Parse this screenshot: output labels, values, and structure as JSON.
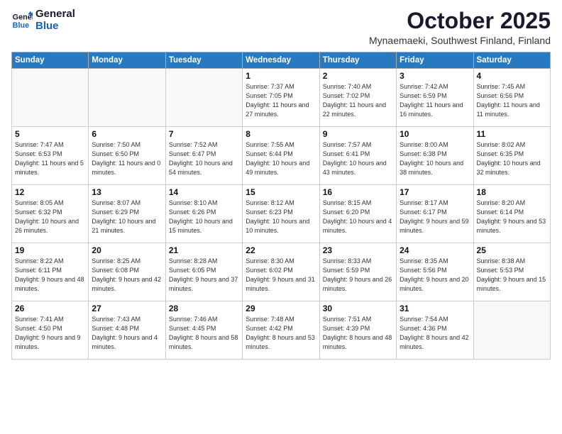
{
  "logo": {
    "line1": "General",
    "line2": "Blue"
  },
  "header": {
    "title": "October 2025",
    "location": "Mynaemaeki, Southwest Finland, Finland"
  },
  "days_of_week": [
    "Sunday",
    "Monday",
    "Tuesday",
    "Wednesday",
    "Thursday",
    "Friday",
    "Saturday"
  ],
  "weeks": [
    [
      {
        "day": "",
        "info": ""
      },
      {
        "day": "",
        "info": ""
      },
      {
        "day": "",
        "info": ""
      },
      {
        "day": "1",
        "info": "Sunrise: 7:37 AM\nSunset: 7:05 PM\nDaylight: 11 hours\nand 27 minutes."
      },
      {
        "day": "2",
        "info": "Sunrise: 7:40 AM\nSunset: 7:02 PM\nDaylight: 11 hours\nand 22 minutes."
      },
      {
        "day": "3",
        "info": "Sunrise: 7:42 AM\nSunset: 6:59 PM\nDaylight: 11 hours\nand 16 minutes."
      },
      {
        "day": "4",
        "info": "Sunrise: 7:45 AM\nSunset: 6:56 PM\nDaylight: 11 hours\nand 11 minutes."
      }
    ],
    [
      {
        "day": "5",
        "info": "Sunrise: 7:47 AM\nSunset: 6:53 PM\nDaylight: 11 hours\nand 5 minutes."
      },
      {
        "day": "6",
        "info": "Sunrise: 7:50 AM\nSunset: 6:50 PM\nDaylight: 11 hours\nand 0 minutes."
      },
      {
        "day": "7",
        "info": "Sunrise: 7:52 AM\nSunset: 6:47 PM\nDaylight: 10 hours\nand 54 minutes."
      },
      {
        "day": "8",
        "info": "Sunrise: 7:55 AM\nSunset: 6:44 PM\nDaylight: 10 hours\nand 49 minutes."
      },
      {
        "day": "9",
        "info": "Sunrise: 7:57 AM\nSunset: 6:41 PM\nDaylight: 10 hours\nand 43 minutes."
      },
      {
        "day": "10",
        "info": "Sunrise: 8:00 AM\nSunset: 6:38 PM\nDaylight: 10 hours\nand 38 minutes."
      },
      {
        "day": "11",
        "info": "Sunrise: 8:02 AM\nSunset: 6:35 PM\nDaylight: 10 hours\nand 32 minutes."
      }
    ],
    [
      {
        "day": "12",
        "info": "Sunrise: 8:05 AM\nSunset: 6:32 PM\nDaylight: 10 hours\nand 26 minutes."
      },
      {
        "day": "13",
        "info": "Sunrise: 8:07 AM\nSunset: 6:29 PM\nDaylight: 10 hours\nand 21 minutes."
      },
      {
        "day": "14",
        "info": "Sunrise: 8:10 AM\nSunset: 6:26 PM\nDaylight: 10 hours\nand 15 minutes."
      },
      {
        "day": "15",
        "info": "Sunrise: 8:12 AM\nSunset: 6:23 PM\nDaylight: 10 hours\nand 10 minutes."
      },
      {
        "day": "16",
        "info": "Sunrise: 8:15 AM\nSunset: 6:20 PM\nDaylight: 10 hours\nand 4 minutes."
      },
      {
        "day": "17",
        "info": "Sunrise: 8:17 AM\nSunset: 6:17 PM\nDaylight: 9 hours\nand 59 minutes."
      },
      {
        "day": "18",
        "info": "Sunrise: 8:20 AM\nSunset: 6:14 PM\nDaylight: 9 hours\nand 53 minutes."
      }
    ],
    [
      {
        "day": "19",
        "info": "Sunrise: 8:22 AM\nSunset: 6:11 PM\nDaylight: 9 hours\nand 48 minutes."
      },
      {
        "day": "20",
        "info": "Sunrise: 8:25 AM\nSunset: 6:08 PM\nDaylight: 9 hours\nand 42 minutes."
      },
      {
        "day": "21",
        "info": "Sunrise: 8:28 AM\nSunset: 6:05 PM\nDaylight: 9 hours\nand 37 minutes."
      },
      {
        "day": "22",
        "info": "Sunrise: 8:30 AM\nSunset: 6:02 PM\nDaylight: 9 hours\nand 31 minutes."
      },
      {
        "day": "23",
        "info": "Sunrise: 8:33 AM\nSunset: 5:59 PM\nDaylight: 9 hours\nand 26 minutes."
      },
      {
        "day": "24",
        "info": "Sunrise: 8:35 AM\nSunset: 5:56 PM\nDaylight: 9 hours\nand 20 minutes."
      },
      {
        "day": "25",
        "info": "Sunrise: 8:38 AM\nSunset: 5:53 PM\nDaylight: 9 hours\nand 15 minutes."
      }
    ],
    [
      {
        "day": "26",
        "info": "Sunrise: 7:41 AM\nSunset: 4:50 PM\nDaylight: 9 hours\nand 9 minutes."
      },
      {
        "day": "27",
        "info": "Sunrise: 7:43 AM\nSunset: 4:48 PM\nDaylight: 9 hours\nand 4 minutes."
      },
      {
        "day": "28",
        "info": "Sunrise: 7:46 AM\nSunset: 4:45 PM\nDaylight: 8 hours\nand 58 minutes."
      },
      {
        "day": "29",
        "info": "Sunrise: 7:48 AM\nSunset: 4:42 PM\nDaylight: 8 hours\nand 53 minutes."
      },
      {
        "day": "30",
        "info": "Sunrise: 7:51 AM\nSunset: 4:39 PM\nDaylight: 8 hours\nand 48 minutes."
      },
      {
        "day": "31",
        "info": "Sunrise: 7:54 AM\nSunset: 4:36 PM\nDaylight: 8 hours\nand 42 minutes."
      },
      {
        "day": "",
        "info": ""
      }
    ]
  ]
}
